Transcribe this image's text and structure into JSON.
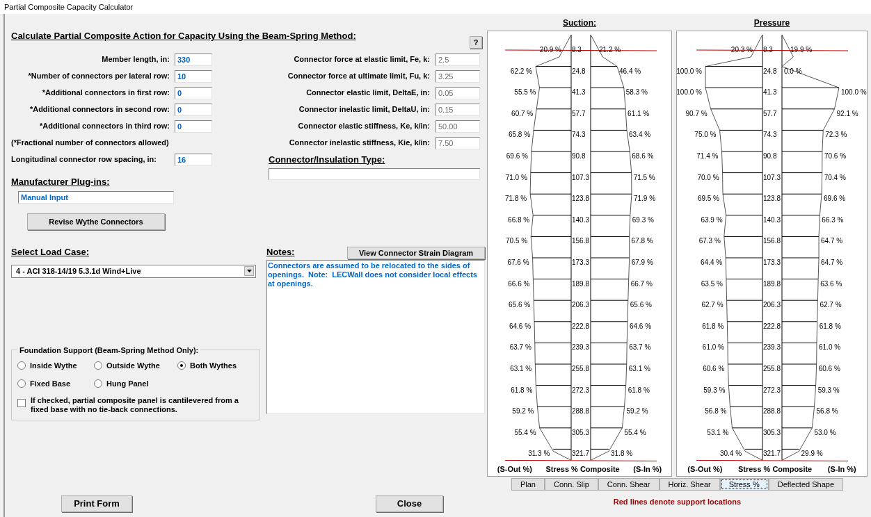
{
  "window": {
    "title": "Partial Composite Capacity Calculator"
  },
  "heading": "Calculate Partial Composite Action for Capacity Using the Beam-Spring Method:",
  "help_button": "?",
  "connector_inputs": [
    {
      "label": "Member length, in:",
      "value": "330"
    },
    {
      "label": "*Number of connectors per lateral row:",
      "value": "10"
    },
    {
      "label": "*Additional connectors in first row:",
      "value": "0"
    },
    {
      "label": "*Additional connectors in second row:",
      "value": "0"
    },
    {
      "label": "*Additional connectors in third row:",
      "value": "0"
    }
  ],
  "fractional_note": "(*Fractional number of connectors allowed)",
  "row_spacing": {
    "label": "Longitudinal connector row spacing, in:",
    "value": "16"
  },
  "connector_properties": [
    {
      "label": "Connector force at elastic limit, Fe, k:",
      "value": "2.5",
      "disabled": true
    },
    {
      "label": "Connector force at ultimate limit, Fu, k:",
      "value": "3.25",
      "disabled": true
    },
    {
      "label": "Connector elastic limit, DeltaE, in:",
      "value": "0.05",
      "disabled": true
    },
    {
      "label": "Connector inelastic limit, DeltaU, in:",
      "value": "0.15",
      "disabled": true
    },
    {
      "label": "Connector elastic stiffness, Ke, k/in:",
      "value": "50.00",
      "disabled": true
    },
    {
      "label": "Connector inelastic stiffness, Kie, k/in:",
      "value": "7.50",
      "disabled": true
    }
  ],
  "connector_type": {
    "label": "Connector/Insulation Type:"
  },
  "manufacturer": {
    "label": "Manufacturer Plug-ins:",
    "value": "Manual Input"
  },
  "revise_button": "Revise Wythe Connectors",
  "load_case": {
    "label": "Select Load Case:",
    "value": "4 - ACI 318-14/19 5.3.1d Wind+Live"
  },
  "notes": {
    "label": "Notes:",
    "button": "View Connector Strain Diagram",
    "text": "Connectors are assumed to be relocated to the sides of openings.  Note:  LECWall does not consider local effects at openings."
  },
  "foundation": {
    "legend": "Foundation Support (Beam-Spring Method Only):",
    "options": [
      {
        "label": "Inside Wythe",
        "selected": false
      },
      {
        "label": "Outside Wythe",
        "selected": false
      },
      {
        "label": "Both Wythes",
        "selected": true
      },
      {
        "label": "Fixed Base",
        "selected": false
      },
      {
        "label": "Hung Panel",
        "selected": false
      }
    ],
    "cantilever": {
      "label": "If checked, partial composite panel is cantilevered from a fixed base with no tie-back connections.",
      "checked": false
    }
  },
  "buttons": {
    "print": "Print Form",
    "close": "Close"
  },
  "diagrams": [
    {
      "title": "Suction:",
      "footer": [
        "(S-Out %)",
        "Stress % Composite",
        "(S-In %)"
      ],
      "rows": [
        {
          "depth": "8.3",
          "s_out": "20.9 %",
          "s_in": "21.2 %",
          "support": true
        },
        {
          "depth": "24.8",
          "s_out": "62.2 %",
          "s_in": "46.4 %",
          "support": false
        },
        {
          "depth": "41.3",
          "s_out": "55.5 %",
          "s_in": "58.3 %",
          "support": false
        },
        {
          "depth": "57.7",
          "s_out": "60.7 %",
          "s_in": "61.1 %",
          "support": false
        },
        {
          "depth": "74.3",
          "s_out": "65.8 %",
          "s_in": "63.4 %",
          "support": false
        },
        {
          "depth": "90.8",
          "s_out": "69.6 %",
          "s_in": "68.6 %",
          "support": false
        },
        {
          "depth": "107.3",
          "s_out": "71.0 %",
          "s_in": "71.5 %",
          "support": false
        },
        {
          "depth": "123.8",
          "s_out": "71.8 %",
          "s_in": "71.9 %",
          "support": false
        },
        {
          "depth": "140.3",
          "s_out": "66.8 %",
          "s_in": "69.3 %",
          "support": false
        },
        {
          "depth": "156.8",
          "s_out": "70.5 %",
          "s_in": "67.8 %",
          "support": false
        },
        {
          "depth": "173.3",
          "s_out": "67.6 %",
          "s_in": "67.9 %",
          "support": false
        },
        {
          "depth": "189.8",
          "s_out": "66.6 %",
          "s_in": "66.7 %",
          "support": false
        },
        {
          "depth": "206.3",
          "s_out": "65.6 %",
          "s_in": "65.6 %",
          "support": false
        },
        {
          "depth": "222.8",
          "s_out": "64.6 %",
          "s_in": "64.6 %",
          "support": false
        },
        {
          "depth": "239.3",
          "s_out": "63.7 %",
          "s_in": "63.7 %",
          "support": false
        },
        {
          "depth": "255.8",
          "s_out": "63.1 %",
          "s_in": "63.1 %",
          "support": false
        },
        {
          "depth": "272.3",
          "s_out": "61.8 %",
          "s_in": "61.8 %",
          "support": false
        },
        {
          "depth": "288.8",
          "s_out": "59.2 %",
          "s_in": "59.2 %",
          "support": false
        },
        {
          "depth": "305.3",
          "s_out": "55.4 %",
          "s_in": "55.4 %",
          "support": false
        },
        {
          "depth": "321.7",
          "s_out": "31.3 %",
          "s_in": "31.8 %",
          "support": true
        }
      ]
    },
    {
      "title": "Pressure",
      "footer": [
        "(S-Out %)",
        "Stress % Composite",
        "(S-In %)"
      ],
      "rows": [
        {
          "depth": "8.3",
          "s_out": "20.3 %",
          "s_in": "19.9 %",
          "support": true
        },
        {
          "depth": "24.8",
          "s_out": "100.0 %",
          "s_in": "0.0 %",
          "support": false
        },
        {
          "depth": "41.3",
          "s_out": "100.0 %",
          "s_in": "100.0 %",
          "support": false
        },
        {
          "depth": "57.7",
          "s_out": "90.7 %",
          "s_in": "92.1 %",
          "support": false
        },
        {
          "depth": "74.3",
          "s_out": "75.0 %",
          "s_in": "72.3 %",
          "support": false
        },
        {
          "depth": "90.8",
          "s_out": "71.4 %",
          "s_in": "70.6 %",
          "support": false
        },
        {
          "depth": "107.3",
          "s_out": "70.0 %",
          "s_in": "70.4 %",
          "support": false
        },
        {
          "depth": "123.8",
          "s_out": "69.5 %",
          "s_in": "69.6 %",
          "support": false
        },
        {
          "depth": "140.3",
          "s_out": "63.9 %",
          "s_in": "66.3 %",
          "support": false
        },
        {
          "depth": "156.8",
          "s_out": "67.3 %",
          "s_in": "64.7 %",
          "support": false
        },
        {
          "depth": "173.3",
          "s_out": "64.4 %",
          "s_in": "64.7 %",
          "support": false
        },
        {
          "depth": "189.8",
          "s_out": "63.5 %",
          "s_in": "63.6 %",
          "support": false
        },
        {
          "depth": "206.3",
          "s_out": "62.7 %",
          "s_in": "62.7 %",
          "support": false
        },
        {
          "depth": "222.8",
          "s_out": "61.8 %",
          "s_in": "61.8 %",
          "support": false
        },
        {
          "depth": "239.3",
          "s_out": "61.0 %",
          "s_in": "61.0 %",
          "support": false
        },
        {
          "depth": "255.8",
          "s_out": "60.6 %",
          "s_in": "60.6 %",
          "support": false
        },
        {
          "depth": "272.3",
          "s_out": "59.3 %",
          "s_in": "59.3 %",
          "support": false
        },
        {
          "depth": "288.8",
          "s_out": "56.8 %",
          "s_in": "56.8 %",
          "support": false
        },
        {
          "depth": "305.3",
          "s_out": "53.1 %",
          "s_in": "53.0 %",
          "support": false
        },
        {
          "depth": "321.7",
          "s_out": "30.4 %",
          "s_in": "29.9 %",
          "support": true
        }
      ]
    }
  ],
  "view_tabs": [
    {
      "label": "Plan",
      "selected": false
    },
    {
      "label": "Conn. Slip",
      "selected": false
    },
    {
      "label": "Conn. Shear",
      "selected": false
    },
    {
      "label": "Horiz. Shear",
      "selected": false
    },
    {
      "label": "Stress %",
      "selected": true
    },
    {
      "label": "Deflected Shape",
      "selected": false
    }
  ],
  "legend_note": "Red lines denote support locations"
}
